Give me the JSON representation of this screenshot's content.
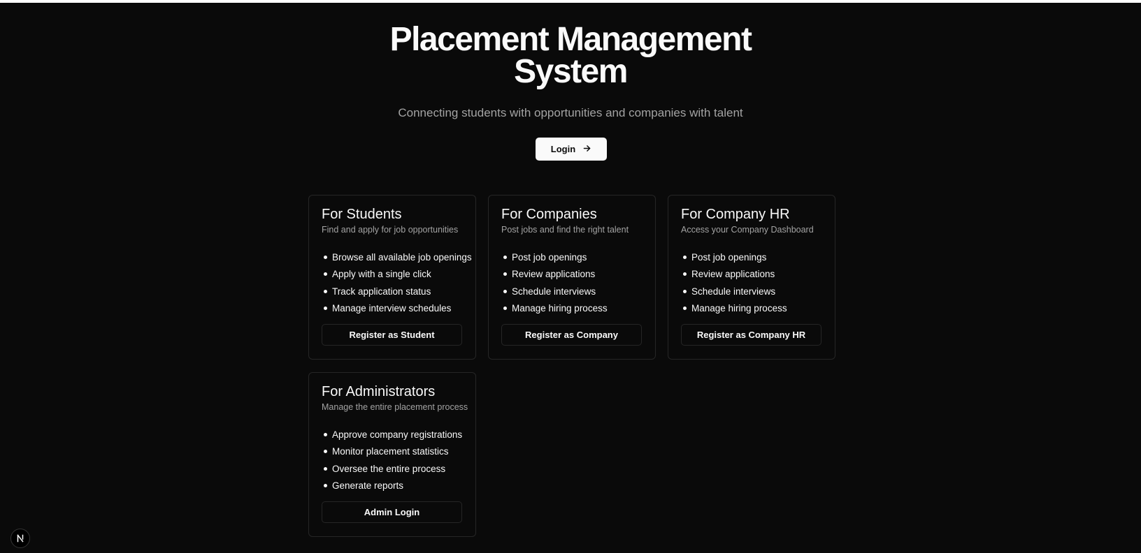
{
  "hero": {
    "title_line1": "Placement Management",
    "title_line2": "System",
    "subtitle": "Connecting students with opportunities and companies with talent",
    "login_label": "Login",
    "login_icon": "arrow-right-icon"
  },
  "cards": [
    {
      "title": "For Students",
      "description": "Find and apply for job opportunities",
      "items": [
        "Browse all available job openings",
        "Apply with a single click",
        "Track application status",
        "Manage interview schedules"
      ],
      "button_label": "Register as Student"
    },
    {
      "title": "For Companies",
      "description": "Post jobs and find the right talent",
      "items": [
        "Post job openings",
        "Review applications",
        "Schedule interviews",
        "Manage hiring process"
      ],
      "button_label": "Register as Company"
    },
    {
      "title": "For Company HR",
      "description": "Access your Company Dashboard",
      "items": [
        "Post job openings",
        "Review applications",
        "Schedule interviews",
        "Manage hiring process"
      ],
      "button_label": "Register as Company HR"
    },
    {
      "title": "For Administrators",
      "description": "Manage the entire placement process",
      "items": [
        "Approve company registrations",
        "Monitor placement statistics",
        "Oversee the entire process",
        "Generate reports"
      ],
      "button_label": "Admin Login"
    }
  ],
  "dev_badge": {
    "letter": "N",
    "icon": "nextjs-logo-icon"
  },
  "colors": {
    "background": "#0a0a0a",
    "foreground": "#fafafa",
    "muted": "#a3a3a3",
    "border": "#262626"
  }
}
